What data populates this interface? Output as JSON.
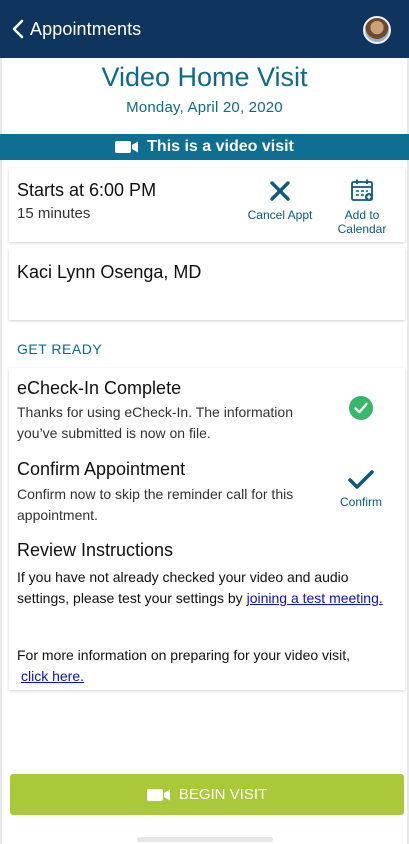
{
  "header": {
    "back_label": "Appointments"
  },
  "visit": {
    "title": "Video Home Visit",
    "date": "Monday, April 20, 2020",
    "banner": "This is a video visit"
  },
  "appointment": {
    "starts": "Starts at 6:00 PM",
    "duration": "15 minutes",
    "cancel_label": "Cancel Appt",
    "add_calendar_line1": "Add to",
    "add_calendar_line2": "Calendar",
    "provider": "Kaci Lynn Osenga, MD"
  },
  "get_ready": {
    "label": "GET READY",
    "echeckin_title": "eCheck-In Complete",
    "echeckin_text": "Thanks for using eCheck-In. The information you’ve submitted is now on file.",
    "confirm_title": "Confirm Appointment",
    "confirm_text": "Confirm now to skip the reminder call for this appointment.",
    "confirm_button": "Confirm",
    "review_title": "Review Instructions",
    "review_text_1": "If you have not already checked your video and audio settings, please test your settings by ",
    "review_link_1": "joining a test meeting.",
    "review_text_2": "For more information on preparing for your video visit,",
    "review_link_2": "click here."
  },
  "footer": {
    "begin_label": "BEGIN VISIT"
  },
  "icons": {
    "back": "chevron-left-icon",
    "video": "video-camera-icon",
    "cancel": "close-icon",
    "calendar": "calendar-add-icon",
    "check_complete": "check-circle-icon",
    "confirm": "checkmark-icon"
  },
  "colors": {
    "header_bg": "#0f355e",
    "accent": "#0d6b87",
    "banner_bg": "#0f6f93",
    "success": "#39b66a",
    "begin_button": "#a9c93a",
    "link": "#1010c8"
  }
}
